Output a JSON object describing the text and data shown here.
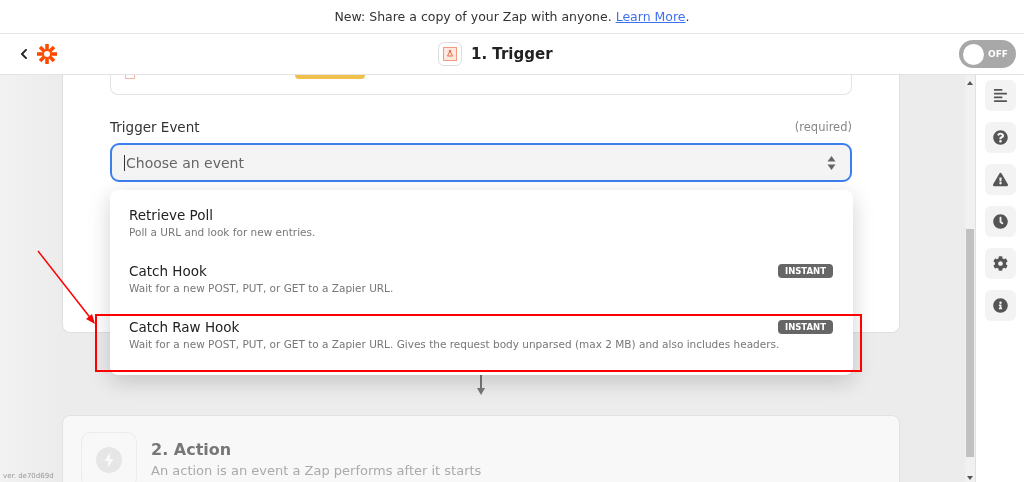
{
  "banner": {
    "text": "New: Share a copy of your Zap with anyone. ",
    "link": "Learn More",
    "trailing": "."
  },
  "header": {
    "title": "1. Trigger",
    "toggle": {
      "label": "OFF",
      "on": false
    }
  },
  "trigger_event": {
    "label": "Trigger Event",
    "hint": "(required)",
    "placeholder": "Choose an event",
    "focused": true
  },
  "options": [
    {
      "title": "Retrieve Poll",
      "description": "Poll a URL and look for new entries.",
      "highlighted": false
    },
    {
      "title": "Catch Hook",
      "description": "Wait for a new POST, PUT, or GET to a Zapier URL.",
      "badge": "INSTANT",
      "highlighted": false
    },
    {
      "title": "Catch Raw Hook",
      "description": "Wait for a new POST, PUT, or GET to a Zapier URL. Gives the request body unparsed (max 2 MB) and also includes headers.",
      "badge": "INSTANT",
      "highlighted": true
    }
  ],
  "action": {
    "title": "2. Action",
    "description": "An action is an event a Zap performs after it starts"
  },
  "version": "ver. de70d69d"
}
